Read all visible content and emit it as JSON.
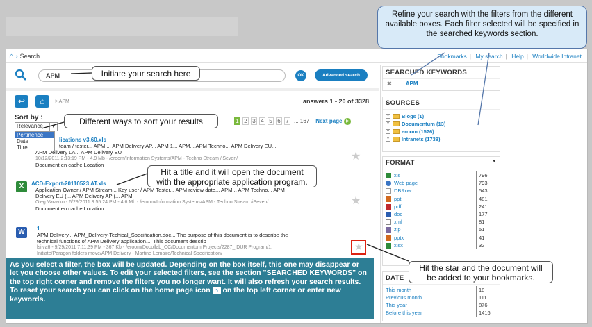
{
  "topbar": {
    "crumb": "Search",
    "links": [
      "Bookmarks",
      "My search",
      "Help",
      "Worldwide Intranet"
    ]
  },
  "search": {
    "value": "APM",
    "ok_label": "OK",
    "advanced_label": "Advanced search"
  },
  "nav": {
    "breadcrumb": "> APM",
    "answers": "answers 1 - 20 of 3328"
  },
  "sort": {
    "label": "Sort by :",
    "selected": "Relevance",
    "options": [
      "Pertinence",
      "Date",
      "Titre"
    ]
  },
  "pager": {
    "pages": [
      "1",
      "2",
      "3",
      "4",
      "5",
      "6",
      "7"
    ],
    "more": "... 167",
    "next": "Next page"
  },
  "results": [
    {
      "title": "lications v3.60.xls",
      "line1": "team / tester... APM ... APM Delivery AP... APM 1... APM... APM Techno... APM Delivery EU...",
      "line2": "APM Delivery LA... APM Delivery EU",
      "meta": "10/12/2011 2:13:19 PM - 4.9 Mb - /eroom/Information Systems/APM - Techno Stream /iSeven/",
      "cache": "Document en cache Location"
    },
    {
      "title": "ACD-Export-20110523 AT.xls",
      "line1": "Application Owner / APM Stream... Key user / APM Tester... APM review date... APM... APM Techno... APM",
      "line2": "Delivery EU (... APM Delivery AP (... APM",
      "meta": "Oleg Varavko - 6/29/2011 3:55:24 PM - 4.6 Mb - /eroom/Information Systems/APM - Techno Stream /iSeven/",
      "cache": "Document en cache Location"
    },
    {
      "title": "1",
      "line1": "APM Delivery... APM_Delivery-Techical_Specification.doc... The purpose of this document is to describe the",
      "line2": "technical functions of APM Delivery application.... This document describ",
      "meta": "lsilva6 - 9/29/2011 7:11:39 PM - 367 Kb - /eroom/Docollab_CC/Documentum Projects/2287_ DUR Program/1.",
      "meta2": "Initiate/Paragon folders move/APM Delivery - Martine Lemaire/Technical Specification/"
    }
  ],
  "sidebar": {
    "searched_keywords_title": "SEARCHED KEYWORDS",
    "keyword": "APM",
    "sources_title": "SOURCES",
    "sources": [
      "Blogs (1)",
      "Documentum (13)",
      "eroom (1576)",
      "Intranets (1738)"
    ],
    "format_title": "FORMAT",
    "formats": [
      {
        "name": "xls",
        "count": "796",
        "color": "#2e8b3a"
      },
      {
        "name": "Web page",
        "count": "793",
        "color": "#3a75c4"
      },
      {
        "name": "DBRow",
        "count": "543",
        "color": "#999999"
      },
      {
        "name": "ppt",
        "count": "481",
        "color": "#d2691e"
      },
      {
        "name": "pdf",
        "count": "241",
        "color": "#c0282c"
      },
      {
        "name": "doc",
        "count": "177",
        "color": "#2a5db0"
      },
      {
        "name": "xml",
        "count": "81",
        "color": "#888888"
      },
      {
        "name": "zip",
        "count": "51",
        "color": "#7a6aa0"
      },
      {
        "name": "pptx",
        "count": "41",
        "color": "#d2691e"
      },
      {
        "name": "xlsx",
        "count": "32",
        "color": "#2e8b3a"
      }
    ],
    "date_title": "DATE",
    "dates": [
      {
        "name": "This month",
        "count": "18"
      },
      {
        "name": "Previous month",
        "count": "111"
      },
      {
        "name": "This year",
        "count": "876"
      },
      {
        "name": "Before this year",
        "count": "1416"
      }
    ]
  },
  "callouts": {
    "filters": "Refine your search with the filters from the different available boxes. Each filter selected will be specified in the searched keywords section.",
    "search": "Initiate your search here",
    "sort": "Different ways to sort your results",
    "title": "Hit a title and it will open the document with the appropriate application program.",
    "star": "Hit the star and the document will be added to your bookmarks."
  },
  "bottom": {
    "p1": "As you select a filter, the box will be updated. Depending on the box itself, this one may disappear or let you choose other values. To edit your selected filters, see the section \"SEARCHED KEYWORDS\" on the top right corner and remove the filters you no longer want. It will also refresh your search results.",
    "p2a": "To reset your search you can click on the home page icon",
    "p2b": "on the top left corner or enter new keywords."
  },
  "colors": {
    "accent": "#1a7fc1",
    "bottom_panel": "#2d7e95",
    "callout_blue": "#d8eaf8",
    "highlight_red": "#dd1111"
  }
}
